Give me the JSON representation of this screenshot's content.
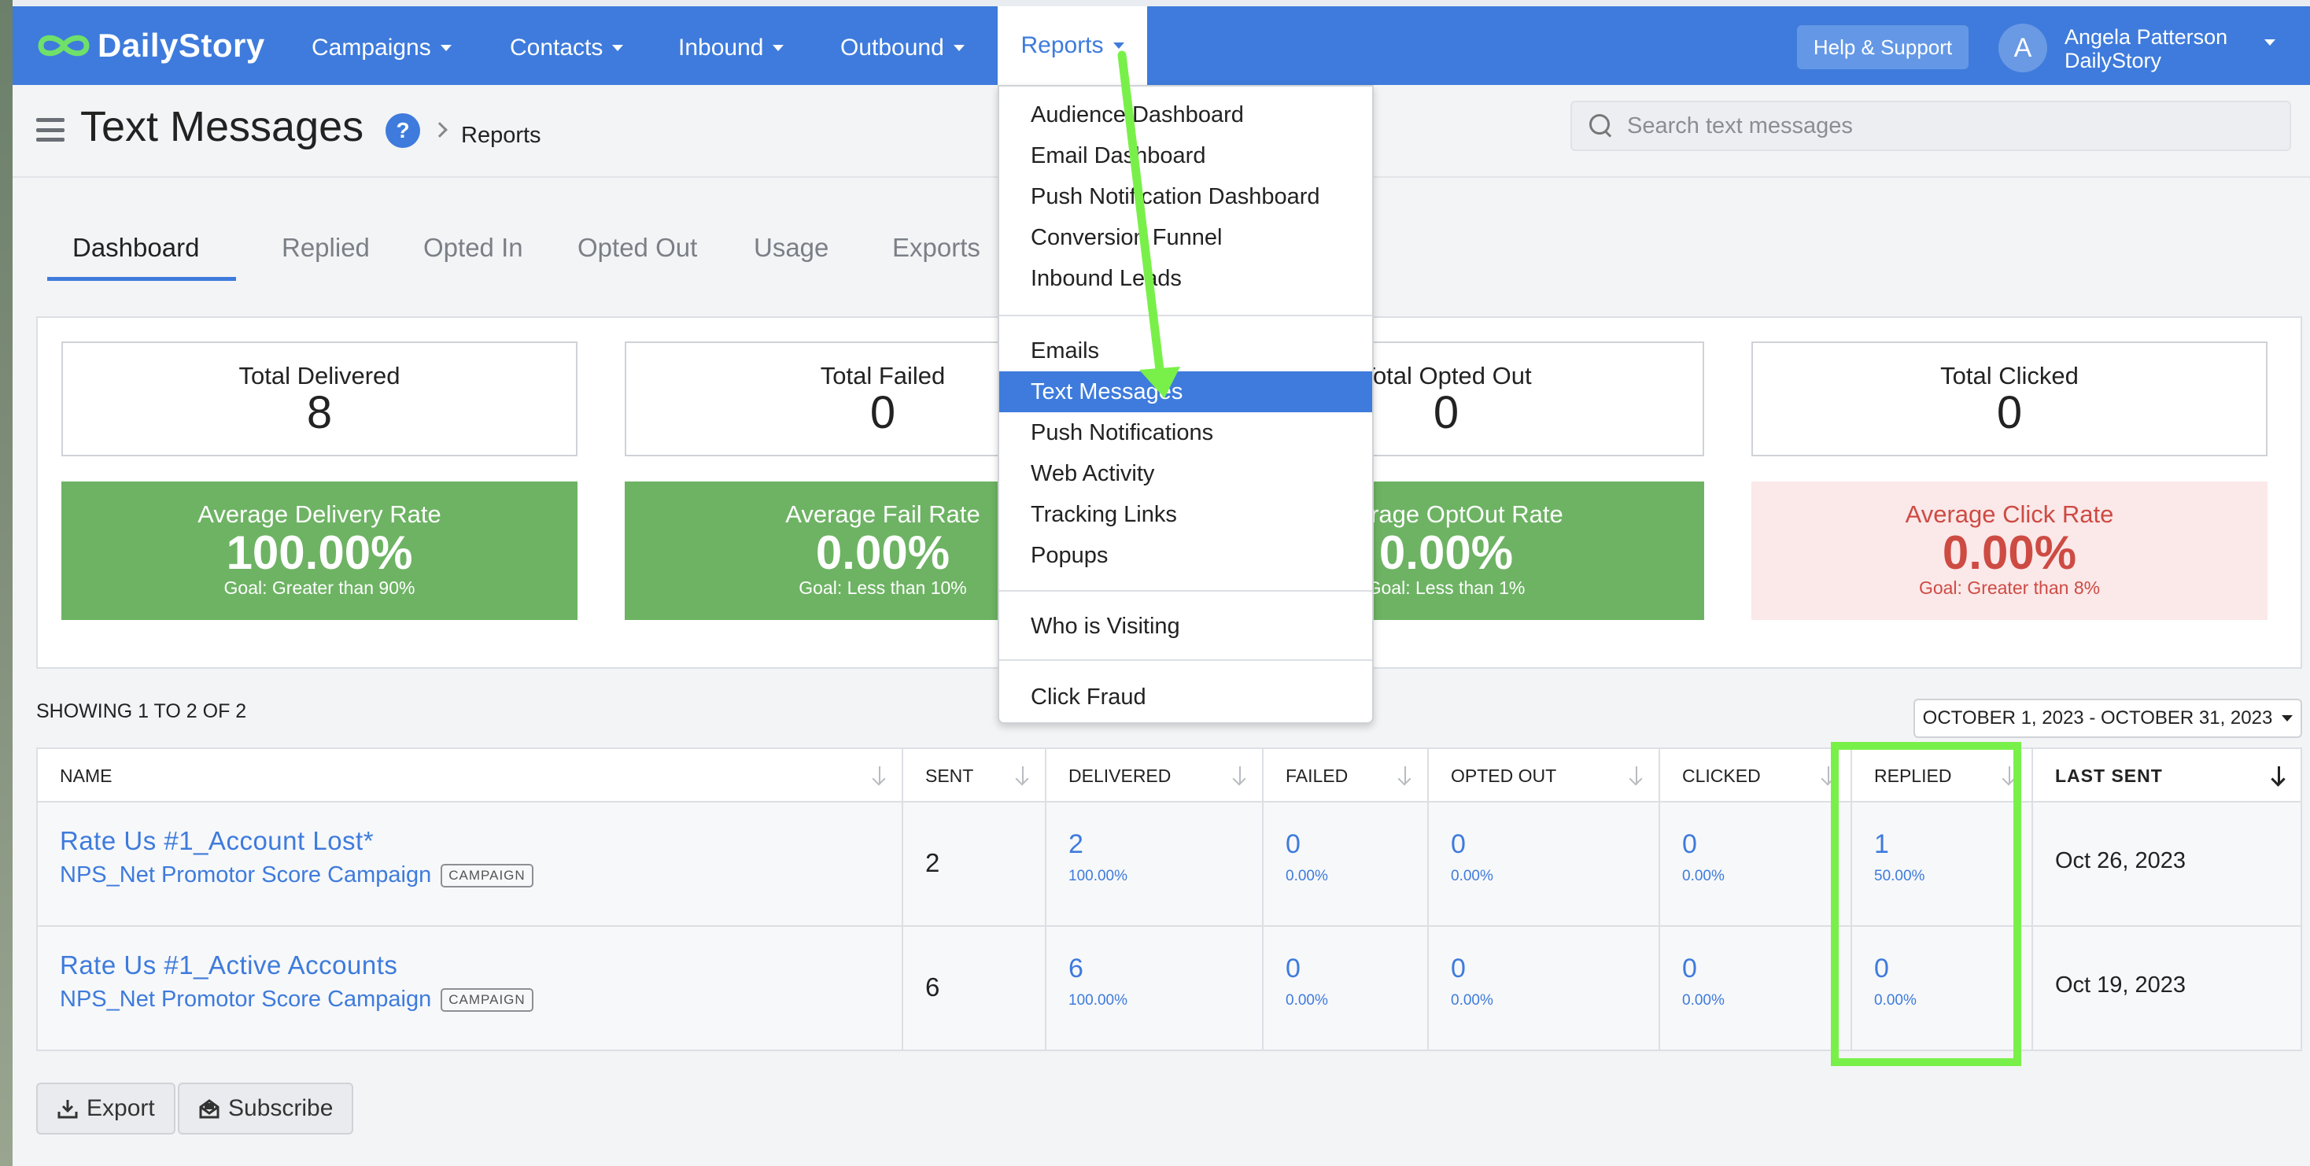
{
  "app": {
    "logo_text": "DailyStory"
  },
  "nav": {
    "items": [
      "Campaigns",
      "Contacts",
      "Inbound",
      "Outbound",
      "Reports"
    ],
    "help_label": "Help & Support",
    "user": {
      "initial": "A",
      "name": "Angela Patterson",
      "org": "DailyStory"
    }
  },
  "header": {
    "title": "Text Messages",
    "help_glyph": "?",
    "breadcrumb": "Reports",
    "search_placeholder": "Search text messages"
  },
  "tabs": [
    "Dashboard",
    "Replied",
    "Opted In",
    "Opted Out",
    "Usage",
    "Exports"
  ],
  "stats": [
    {
      "label": "Total Delivered",
      "value": "8"
    },
    {
      "label": "Total Failed",
      "value": "0"
    },
    {
      "label": "Total Opted Out",
      "value": "0"
    },
    {
      "label": "Total Clicked",
      "value": "0"
    }
  ],
  "rates": [
    {
      "label": "Average Delivery Rate",
      "value": "100.00%",
      "goal": "Goal: Greater than 90%",
      "status": "good"
    },
    {
      "label": "Average Fail Rate",
      "value": "0.00%",
      "goal": "Goal: Less than 10%",
      "status": "good"
    },
    {
      "label": "Average OptOut Rate",
      "value": "0.00%",
      "goal": "Goal: Less than 1%",
      "status": "good"
    },
    {
      "label": "Average Click Rate",
      "value": "0.00%",
      "goal": "Goal: Greater than 8%",
      "status": "bad"
    }
  ],
  "colors": {
    "brand": "#3e7bdc",
    "good": "#6db363",
    "bad_bg": "#fbe8e9",
    "bad_text": "#cd4b43",
    "annotation": "#79f04a"
  },
  "table": {
    "showing": "SHOWING 1 TO 2 OF 2",
    "date_range": "OCTOBER 1, 2023 - OCTOBER 31, 2023",
    "columns": [
      "NAME",
      "SENT",
      "DELIVERED",
      "FAILED",
      "OPTED OUT",
      "CLICKED",
      "REPLIED",
      "LAST SENT"
    ],
    "rows": [
      {
        "name": "Rate Us #1_Account Lost*",
        "campaign": "NPS_Net Promotor Score Campaign",
        "badge": "CAMPAIGN",
        "sent": "2",
        "delivered": "2",
        "delivered_pct": "100.00%",
        "failed": "0",
        "failed_pct": "0.00%",
        "opted_out": "0",
        "opted_out_pct": "0.00%",
        "clicked": "0",
        "clicked_pct": "0.00%",
        "replied": "1",
        "replied_pct": "50.00%",
        "last_sent": "Oct 26, 2023"
      },
      {
        "name": "Rate Us #1_Active Accounts",
        "campaign": "NPS_Net Promotor Score Campaign",
        "badge": "CAMPAIGN",
        "sent": "6",
        "delivered": "6",
        "delivered_pct": "100.00%",
        "failed": "0",
        "failed_pct": "0.00%",
        "opted_out": "0",
        "opted_out_pct": "0.00%",
        "clicked": "0",
        "clicked_pct": "0.00%",
        "replied": "0",
        "replied_pct": "0.00%",
        "last_sent": "Oct 19, 2023"
      }
    ]
  },
  "actions": {
    "export": "Export",
    "subscribe": "Subscribe"
  },
  "dropdown": {
    "groups": [
      [
        "Audience Dashboard",
        "Email Dashboard",
        "Push Notification Dashboard",
        "Conversion Funnel",
        "Inbound Leads"
      ],
      [
        "Emails",
        "Text Messages",
        "Push Notifications",
        "Web Activity",
        "Tracking Links",
        "Popups"
      ],
      [
        "Who is Visiting"
      ],
      [
        "Click Fraud"
      ]
    ],
    "active": "Text Messages"
  }
}
